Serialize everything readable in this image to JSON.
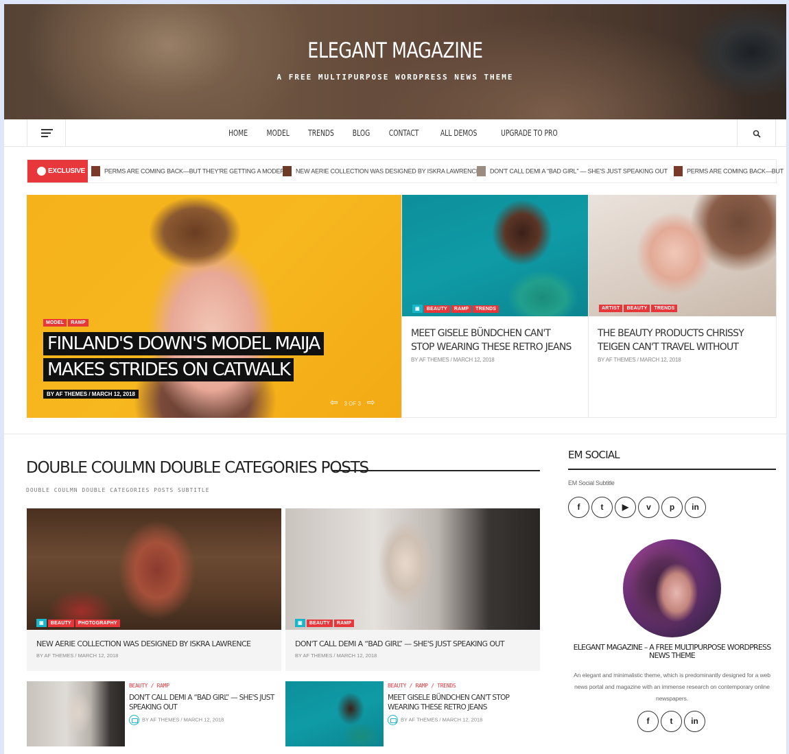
{
  "site": {
    "title": "ELEGANT MAGAZINE",
    "tagline": "A FREE MULTIPURPOSE WORDPRESS NEWS THEME"
  },
  "nav": {
    "items": [
      "HOME",
      "MODEL",
      "TRENDS",
      "BLOG",
      "CONTACT",
      "ALL DEMOS",
      "UPGRADE TO PRO"
    ],
    "search_icon": "search-icon",
    "menu_icon": "hamburger-icon"
  },
  "ticker": {
    "badge": "EXCLUSIVE",
    "items": [
      "PERMS ARE COMING BACK—BUT THEY'RE GETTING A MODERN",
      "NEW AERIE COLLECTION WAS DESIGNED BY ISKRA LAWRENCE",
      "DON'T CALL DEMI A “BAD GIRL” — SHE'S JUST SPEAKING OUT",
      "PERMS ARE COMING BACK—BUT"
    ]
  },
  "slider": {
    "main": {
      "tags": [
        "MODEL",
        "RAMP"
      ],
      "title": "FINLAND'S DOWN'S MODEL MAIJA MAKES STRIDES ON CATWALK",
      "meta": "BY AF THEMES / MARCH 12, 2018",
      "pager": "3 OF 3"
    },
    "cards": [
      {
        "tags": [
          "BEAUTY",
          "RAMP",
          "TRENDS"
        ],
        "title": "MEET GISELE BÜNDCHEN CAN'T STOP WEARING THESE RETRO JEANS",
        "meta": "BY AF THEMES / MARCH 12, 2018"
      },
      {
        "tags": [
          "ARTIST",
          "BEAUTY",
          "TRENDS"
        ],
        "title": "THE BEAUTY PRODUCTS CHRISSY TEIGEN CAN'T TRAVEL WITHOUT",
        "meta": "BY AF THEMES / MARCH 12, 2018"
      }
    ]
  },
  "section": {
    "title": "DOUBLE COULMN DOUBLE CATEGORIES POSTS",
    "subtitle": "DOUBLE COULMN DOUBLE CATEGORIES POSTS SUBTITLE",
    "grid": [
      {
        "tags": [
          "BEAUTY",
          "PHOTOGRAPHY"
        ],
        "title": "NEW AERIE COLLECTION WAS DESIGNED BY ISKRA LAWRENCE",
        "meta": "BY AF THEMES / MARCH 12, 2018"
      },
      {
        "tags": [
          "BEAUTY",
          "RAMP"
        ],
        "title": "DON'T CALL DEMI A “BAD GIRL” — SHE'S JUST SPEAKING OUT",
        "meta": "BY AF THEMES / MARCH 12, 2018"
      }
    ],
    "list": [
      {
        "cats": "BEAUTY / RAMP",
        "title": "DON'T CALL DEMI A “BAD GIRL” — SHE'S JUST SPEAKING OUT",
        "meta": "BY AF THEMES / MARCH 12, 2018"
      },
      {
        "cats": "BEAUTY / RAMP / TRENDS",
        "title": "MEET GISELE BÜNDCHEN CAN'T STOP WEARING THESE RETRO JEANS",
        "meta": "BY AF THEMES / MARCH 12, 2018"
      }
    ]
  },
  "sidebar": {
    "title": "EM SOCIAL",
    "subtitle": "EM Social Subtitle",
    "social": [
      "f",
      "t",
      "▶",
      "v",
      "p",
      "in"
    ],
    "author_name": "ELEGANT MAGAZINE – A FREE MULTIPURPOSE WORDPRESS NEWS THEME",
    "author_desc": "An elegant and minimalistic theme, which is predominantly designed for a web news portal and magazine with an immense research on contemporary online newspapers.",
    "author_social": [
      "f",
      "t",
      "in"
    ]
  },
  "colors": {
    "accent": "#e8373b",
    "teal": "#18b6c8",
    "yellow": "#f6b21a"
  }
}
